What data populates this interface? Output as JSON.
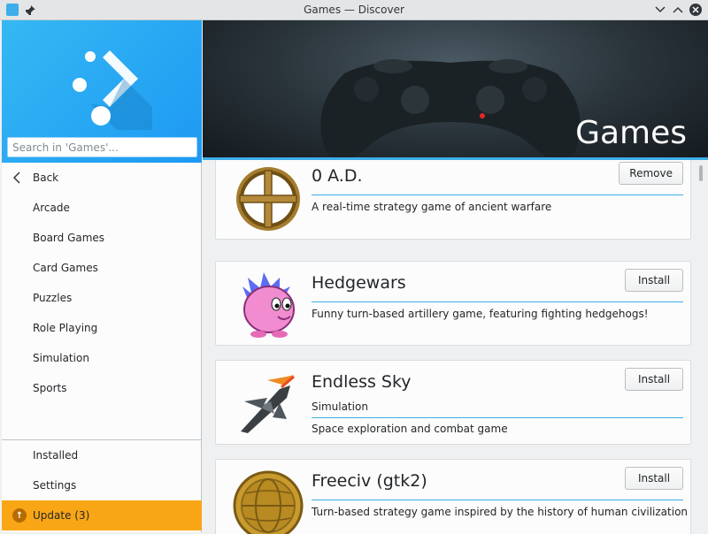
{
  "window": {
    "title": "Games — Discover"
  },
  "sidebar": {
    "search_placeholder": "Search in 'Games'...",
    "back_label": "Back",
    "categories": [
      "Arcade",
      "Board Games",
      "Card Games",
      "Puzzles",
      "Role Playing",
      "Simulation",
      "Sports"
    ],
    "installed_label": "Installed",
    "settings_label": "Settings",
    "update_label": "Update (3)"
  },
  "banner": {
    "title": "Games"
  },
  "apps": [
    {
      "name": "0 A.D.",
      "category": "",
      "description": "A real-time strategy game of ancient warfare",
      "action": "Remove"
    },
    {
      "name": "Hedgewars",
      "category": "",
      "description": "Funny turn-based artillery game, featuring fighting hedgehogs!",
      "action": "Install"
    },
    {
      "name": "Endless Sky",
      "category": "Simulation",
      "description": "Space exploration and combat game",
      "action": "Install"
    },
    {
      "name": "Freeciv (gtk2)",
      "category": "",
      "description": "Turn-based strategy game inspired by the history of human civilization",
      "action": "Install"
    }
  ],
  "colors": {
    "accent": "#3daee9",
    "sidebar_header": "#1d99f3",
    "update_highlight": "#f9a616"
  }
}
